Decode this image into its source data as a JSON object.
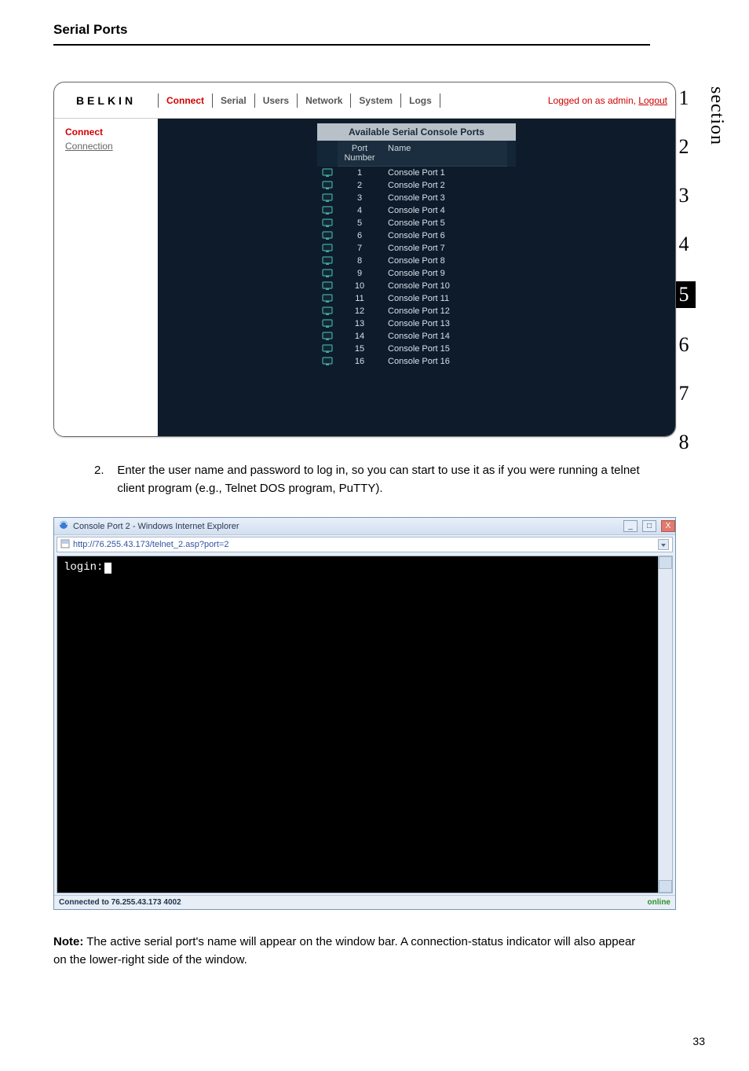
{
  "page_title": "Serial Ports",
  "side_label": "section",
  "section_numbers": [
    "1",
    "2",
    "3",
    "4",
    "5",
    "6",
    "7",
    "8"
  ],
  "active_section": "5",
  "belkin": {
    "brand": "BELKIN",
    "nav": [
      "Connect",
      "Serial",
      "Users",
      "Network",
      "System",
      "Logs"
    ],
    "logged_prefix": "Logged on as admin, ",
    "logged_link": "Logout",
    "side_heading": "Connect",
    "side_link": "Connection",
    "ports_title": "Available Serial Console Ports",
    "head_port": "Port\nNumber",
    "head_name": "Name",
    "ports": [
      {
        "num": "1",
        "name": "Console Port 1"
      },
      {
        "num": "2",
        "name": "Console Port 2"
      },
      {
        "num": "3",
        "name": "Console Port 3"
      },
      {
        "num": "4",
        "name": "Console Port 4"
      },
      {
        "num": "5",
        "name": "Console Port 5"
      },
      {
        "num": "6",
        "name": "Console Port 6"
      },
      {
        "num": "7",
        "name": "Console Port 7"
      },
      {
        "num": "8",
        "name": "Console Port 8"
      },
      {
        "num": "9",
        "name": "Console Port 9"
      },
      {
        "num": "10",
        "name": "Console Port 10"
      },
      {
        "num": "11",
        "name": "Console Port 11"
      },
      {
        "num": "12",
        "name": "Console Port 12"
      },
      {
        "num": "13",
        "name": "Console Port 13"
      },
      {
        "num": "14",
        "name": "Console Port 14"
      },
      {
        "num": "15",
        "name": "Console Port 15"
      },
      {
        "num": "16",
        "name": "Console Port 16"
      }
    ]
  },
  "step": {
    "number": "2.",
    "text": "Enter the user name and password to log in, so you can start to use it as if you were running a telnet client program (e.g., Telnet DOS program, PuTTY)."
  },
  "ie": {
    "title": "Console Port 2 - Windows Internet Explorer",
    "url": "http://76.255.43.173/telnet_2.asp?port=2",
    "terminal_prompt": "login:",
    "status_left": "Connected to 76.255.43.173 4002",
    "status_right": "online"
  },
  "note": {
    "label": "Note:",
    "text": " The active serial port's name will appear on the window bar. A connection-status indicator will also appear on the lower-right side of the window."
  },
  "page_number": "33"
}
